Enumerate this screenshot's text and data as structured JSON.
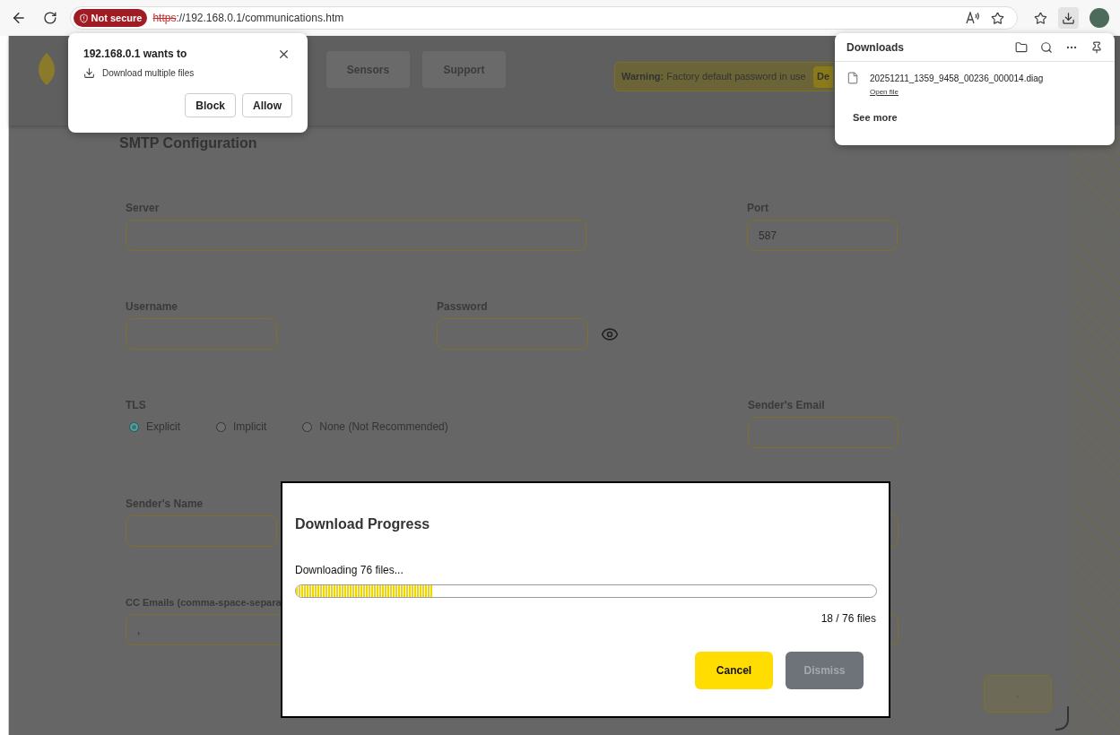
{
  "browser": {
    "badge": "Not secure",
    "scheme": "https",
    "url": "://192.168.0.1/communications.htm"
  },
  "permission_popup": {
    "title": "192.168.0.1 wants to",
    "item": "Download multiple files",
    "buttons": [
      "Block",
      "Allow"
    ]
  },
  "downloads_panel": {
    "title": "Downloads",
    "file": "20251211_1359_9458_00236_000014.diag",
    "link": "Open file",
    "see_more": "See more"
  },
  "header": {
    "nav": [
      "Sensors",
      "Support"
    ],
    "warning_label": "Warning:",
    "warning_text": "Factory default password in use",
    "warning_button": "De"
  },
  "form": {
    "title": "SMTP Configuration",
    "server": {
      "label": "Server"
    },
    "port": {
      "label": "Port",
      "value": "587"
    },
    "username": {
      "label": "Username"
    },
    "password": {
      "label": "Password"
    },
    "tls": {
      "label": "TLS",
      "options": [
        {
          "label": "Explicit",
          "selected": true
        },
        {
          "label": "Implicit",
          "selected": false
        },
        {
          "label": "None (Not Recommended)",
          "selected": false
        }
      ]
    },
    "senders_email": {
      "label": "Sender's Email"
    },
    "senders_name": {
      "label": "Sender's Name"
    },
    "cc": {
      "label": "CC Emails (comma-space-separa",
      "value": ","
    },
    "save_button": "."
  },
  "modal": {
    "title": "Download Progress",
    "status": "Downloading 76 files...",
    "level": 0.235,
    "count": "18 / 76 files",
    "buttons": [
      {
        "label": "Cancel",
        "kind": "primary",
        "disabled": false
      },
      {
        "label": "Dismiss",
        "kind": "secondary",
        "disabled": true
      }
    ]
  }
}
